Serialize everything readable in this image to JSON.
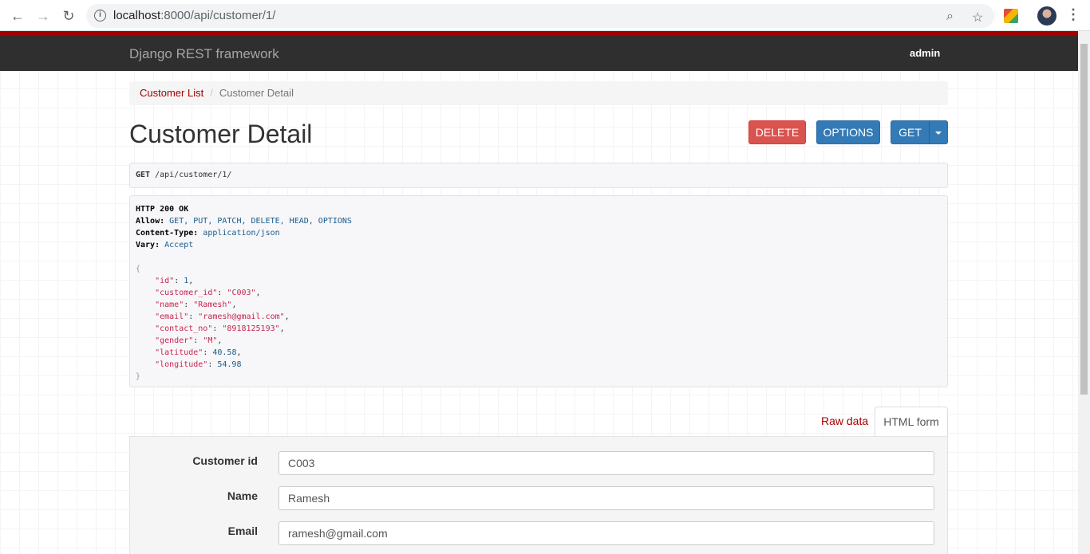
{
  "browser": {
    "url_host": "localhost",
    "url_rest": ":8000/api/customer/1/"
  },
  "navbar": {
    "brand": "Django REST framework",
    "user": "admin"
  },
  "breadcrumb": {
    "items": [
      "Customer List",
      "Customer Detail"
    ]
  },
  "page_title": "Customer Detail",
  "actions": {
    "delete": "DELETE",
    "options": "OPTIONS",
    "get": "GET"
  },
  "request": {
    "method": "GET",
    "path": "/api/customer/1/"
  },
  "response": {
    "status": "HTTP 200 OK",
    "headers": [
      {
        "name": "Allow",
        "value": "GET, PUT, PATCH, DELETE, HEAD, OPTIONS"
      },
      {
        "name": "Content-Type",
        "value": "application/json"
      },
      {
        "name": "Vary",
        "value": "Accept"
      }
    ],
    "body": [
      {
        "key": "id",
        "value": "1",
        "kind": "number"
      },
      {
        "key": "customer_id",
        "value": "C003",
        "kind": "string"
      },
      {
        "key": "name",
        "value": "Ramesh",
        "kind": "string"
      },
      {
        "key": "email",
        "value": "ramesh@gmail.com",
        "kind": "string"
      },
      {
        "key": "contact_no",
        "value": "8918125193",
        "kind": "string"
      },
      {
        "key": "gender",
        "value": "M",
        "kind": "string"
      },
      {
        "key": "latitude",
        "value": "40.58",
        "kind": "number"
      },
      {
        "key": "longitude",
        "value": "54.98",
        "kind": "number"
      }
    ]
  },
  "tabs": {
    "raw": "Raw data",
    "html": "HTML form"
  },
  "form": {
    "fields": [
      {
        "label": "Customer id",
        "value": "C003"
      },
      {
        "label": "Name",
        "value": "Ramesh"
      },
      {
        "label": "Email",
        "value": "ramesh@gmail.com"
      }
    ]
  },
  "colors": {
    "accent": "#a30000",
    "navbar": "#2f2f2f",
    "danger": "#d9534f",
    "primary": "#337ab7"
  }
}
